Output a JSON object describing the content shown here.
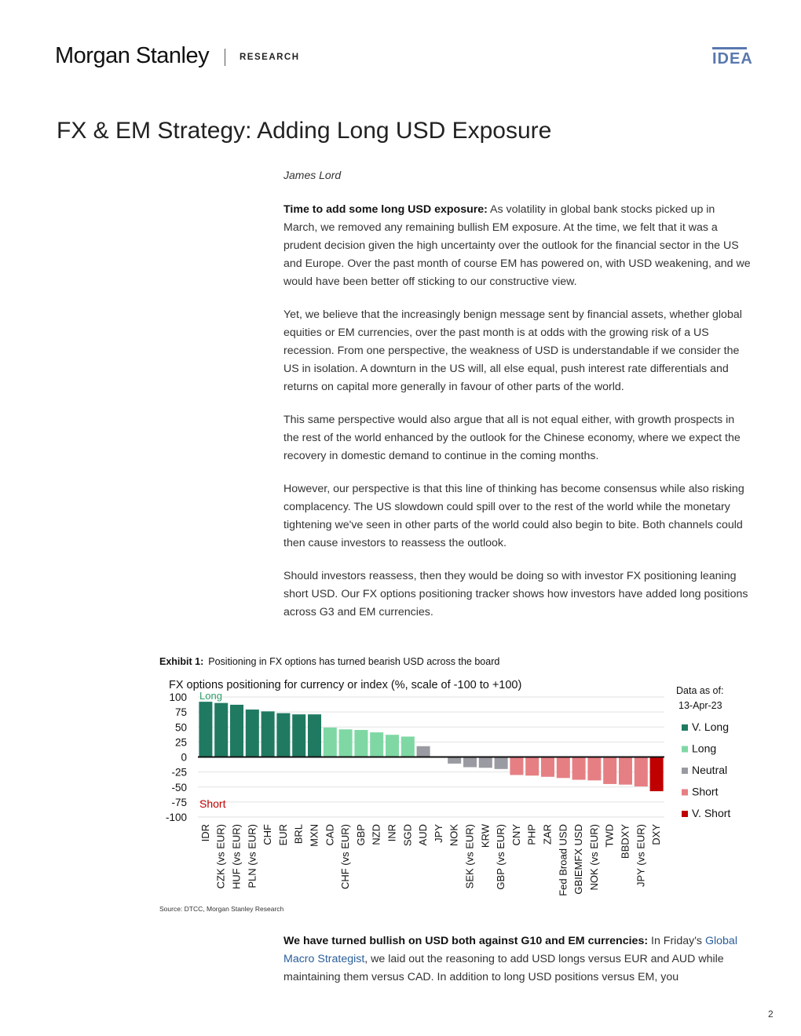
{
  "header": {
    "brand": "Morgan Stanley",
    "section": "RESEARCH",
    "badge": "IDEA"
  },
  "title": "FX & EM Strategy: Adding Long USD Exposure",
  "author": "James Lord",
  "paragraphs": [
    {
      "lead": "Time to add some long USD exposure:",
      "text": " As volatility in global bank stocks picked up in March, we removed any remaining bullish EM exposure. At the time, we felt that it was a prudent decision given the high uncertainty over the outlook for the financial sector in the US and Europe. Over the past month of course EM has powered on, with USD weakening, and we would have been better off sticking to our constructive view."
    },
    {
      "text": "Yet, we believe that the increasingly benign message sent by financial assets, whether global equities or EM currencies, over the past month is at odds with the growing risk of a US recession. From one perspective, the weakness of USD is understandable if we consider the US in isolation. A downturn in the US will, all else equal, push interest rate differentials and returns on capital more generally in favour of other parts of the world."
    },
    {
      "text": "This same perspective would also argue that all is not equal either, with growth prospects in the rest of the world enhanced by the outlook for the Chinese economy, where we expect the recovery in domestic demand to continue in the coming months."
    },
    {
      "text": "However, our perspective is that this line of thinking has become consensus while also risking complacency. The US slowdown could spill over to the rest of the world while the monetary tightening we've seen in other parts of the world could also begin to bite. Both channels could then cause investors to reassess the outlook."
    },
    {
      "text": "Should investors reassess, then they would be doing so with investor FX positioning leaning short USD. Our FX options positioning tracker shows how investors have added long positions across G3 and EM currencies."
    }
  ],
  "exhibit": {
    "label": "Exhibit 1:",
    "caption": "Positioning in FX options has turned bearish USD across the board"
  },
  "source": "Source: DTCC, Morgan Stanley Research",
  "closing": {
    "lead": "We have turned bullish on USD both against G10 and EM currencies:",
    "text_before": " In Friday's ",
    "link": "Global Macro Strategist",
    "text_after": ", we laid out the reasoning to add USD longs versus EUR and AUD while maintaining them versus CAD. In addition to long USD positions versus EM, you"
  },
  "page_number": "2",
  "chart_data": {
    "type": "bar",
    "title": "FX options positioning for currency or index (%, scale of -100 to +100)",
    "ylim": [
      -100,
      100
    ],
    "yticks": [
      100,
      75,
      50,
      25,
      0,
      -25,
      -50,
      -75,
      -100
    ],
    "annotations": {
      "top": "Long",
      "bottom": "Short"
    },
    "data_as_of_label": "Data as of:",
    "data_as_of_date": "13-Apr-23",
    "legend": [
      {
        "key": "vlong",
        "label": "V. Long",
        "color": "#207a62"
      },
      {
        "key": "long",
        "label": "Long",
        "color": "#7fd8a4"
      },
      {
        "key": "neutral",
        "label": "Neutral",
        "color": "#9a9aa2"
      },
      {
        "key": "short",
        "label": "Short",
        "color": "#e67f83"
      },
      {
        "key": "vshort",
        "label": "V. Short",
        "color": "#c00000"
      }
    ],
    "categories": [
      "IDR",
      "CZK (vs EUR)",
      "HUF (vs EUR)",
      "PLN (vs EUR)",
      "CHF",
      "EUR",
      "BRL",
      "MXN",
      "CAD",
      "CHF (vs EUR)",
      "GBP",
      "NZD",
      "INR",
      "SGD",
      "AUD",
      "JPY",
      "NOK",
      "SEK (vs EUR)",
      "KRW",
      "GBP (vs EUR)",
      "CNY",
      "PHP",
      "ZAR",
      "Fed Broad USD",
      "GBIEMFX USD",
      "NOK (vs EUR)",
      "TWD",
      "BBDXY",
      "JPY (vs EUR)",
      "DXY"
    ],
    "values": [
      92,
      90,
      87,
      79,
      76,
      73,
      71,
      71,
      49,
      46,
      45,
      41,
      37,
      34,
      18,
      1,
      -11,
      -17,
      -18,
      -20,
      -30,
      -31,
      -33,
      -35,
      -38,
      -39,
      -45,
      -46,
      -49,
      -57
    ],
    "classes": [
      "vlong",
      "vlong",
      "vlong",
      "vlong",
      "vlong",
      "vlong",
      "vlong",
      "vlong",
      "long",
      "long",
      "long",
      "long",
      "long",
      "long",
      "neutral",
      "neutral",
      "neutral",
      "neutral",
      "neutral",
      "neutral",
      "short",
      "short",
      "short",
      "short",
      "short",
      "short",
      "short",
      "short",
      "short",
      "vshort"
    ]
  }
}
